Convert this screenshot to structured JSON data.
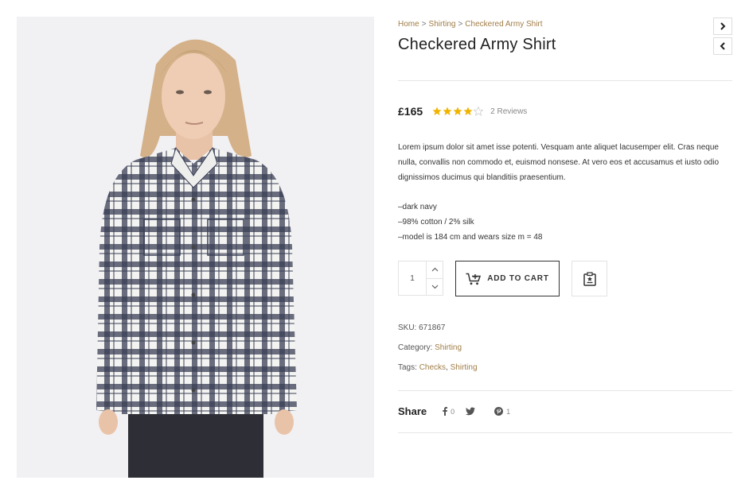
{
  "breadcrumb": {
    "items": [
      "Home",
      "Shirting",
      "Checkered Army Shirt"
    ],
    "separator": ">"
  },
  "product": {
    "title": "Checkered Army Shirt",
    "price": "£165",
    "rating": 4,
    "rating_max": 5,
    "reviews_label": "2 Reviews",
    "description": "Lorem ipsum dolor sit amet isse potenti. Vesquam ante aliquet lacusemper elit. Cras neque nulla, convallis non commodo et, euismod nonsese. At vero eos et accusamus et iusto odio dignissimos ducimus qui blanditiis praesentium.",
    "features": [
      "–dark navy",
      "–98% cotton / 2% silk",
      "–model is 184 cm and wears size m = 48"
    ],
    "quantity": "1",
    "add_to_cart_label": "ADD TO CART",
    "sku_label": "SKU:",
    "sku_value": "671867",
    "category_label": "Category:",
    "category_value": "Shirting",
    "tags_label": "Tags:",
    "tags": [
      "Checks",
      "Shirting"
    ],
    "tags_separator": ","
  },
  "share": {
    "label": "Share",
    "facebook_count": "0",
    "pinterest_count": "1"
  },
  "icons": {
    "next": "chevron-right-icon",
    "prev": "chevron-left-icon",
    "qty_up": "chevron-up-icon",
    "qty_down": "chevron-down-icon",
    "cart": "cart-plus-icon",
    "wishlist": "clipboard-star-icon",
    "facebook": "facebook-icon",
    "twitter": "twitter-icon",
    "pinterest": "pinterest-icon"
  },
  "colors": {
    "accent": "#a07d47",
    "star": "#f0b400",
    "star_empty": "#cccccc"
  }
}
